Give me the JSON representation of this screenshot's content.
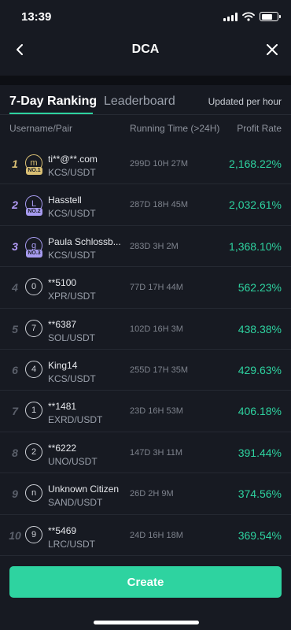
{
  "status_bar": {
    "time": "13:39"
  },
  "nav": {
    "title": "DCA"
  },
  "tabs": [
    {
      "label": "7-Day Ranking"
    },
    {
      "label": "Leaderboard"
    }
  ],
  "updated_label": "Updated per hour",
  "columns": {
    "user": "Username/Pair",
    "time": "Running Time (>24H)",
    "profit": "Profit Rate"
  },
  "rows": [
    {
      "rank": "1",
      "avatar": "m",
      "medal": "NO.1",
      "name": "ti**@**.com",
      "pair": "KCS/USDT",
      "time": "299D 10H 27M",
      "profit": "2,168.22%"
    },
    {
      "rank": "2",
      "avatar": "L",
      "medal": "NO.2",
      "name": "Hasstell",
      "pair": "KCS/USDT",
      "time": "287D 18H 45M",
      "profit": "2,032.61%"
    },
    {
      "rank": "3",
      "avatar": "g",
      "medal": "NO.3",
      "name": "Paula Schlossb...",
      "pair": "KCS/USDT",
      "time": "283D 3H 2M",
      "profit": "1,368.10%"
    },
    {
      "rank": "4",
      "avatar": "0",
      "medal": "",
      "name": "**5100",
      "pair": "XPR/USDT",
      "time": "77D 17H 44M",
      "profit": "562.23%"
    },
    {
      "rank": "5",
      "avatar": "7",
      "medal": "",
      "name": "**6387",
      "pair": "SOL/USDT",
      "time": "102D 16H 3M",
      "profit": "438.38%"
    },
    {
      "rank": "6",
      "avatar": "4",
      "medal": "",
      "name": "King14",
      "pair": "KCS/USDT",
      "time": "255D 17H 35M",
      "profit": "429.63%"
    },
    {
      "rank": "7",
      "avatar": "1",
      "medal": "",
      "name": "**1481",
      "pair": "EXRD/USDT",
      "time": "23D 16H 53M",
      "profit": "406.18%"
    },
    {
      "rank": "8",
      "avatar": "2",
      "medal": "",
      "name": "**6222",
      "pair": "UNO/USDT",
      "time": "147D 3H 11M",
      "profit": "391.44%"
    },
    {
      "rank": "9",
      "avatar": "n",
      "medal": "",
      "name": "Unknown Citizen",
      "pair": "SAND/USDT",
      "time": "26D 2H 9M",
      "profit": "374.56%"
    },
    {
      "rank": "10",
      "avatar": "9",
      "medal": "",
      "name": "**5469",
      "pair": "LRC/USDT",
      "time": "24D 16H 18M",
      "profit": "369.54%"
    }
  ],
  "create_label": "Create",
  "colors": {
    "accent": "#2ed3a0",
    "gold": "#d9bf74",
    "purple": "#a79bf0",
    "background": "#171a22"
  },
  "icons": {
    "back": "chevron-left-icon",
    "close": "close-icon",
    "signal": "signal-icon",
    "wifi": "wifi-icon",
    "battery": "battery-icon"
  }
}
